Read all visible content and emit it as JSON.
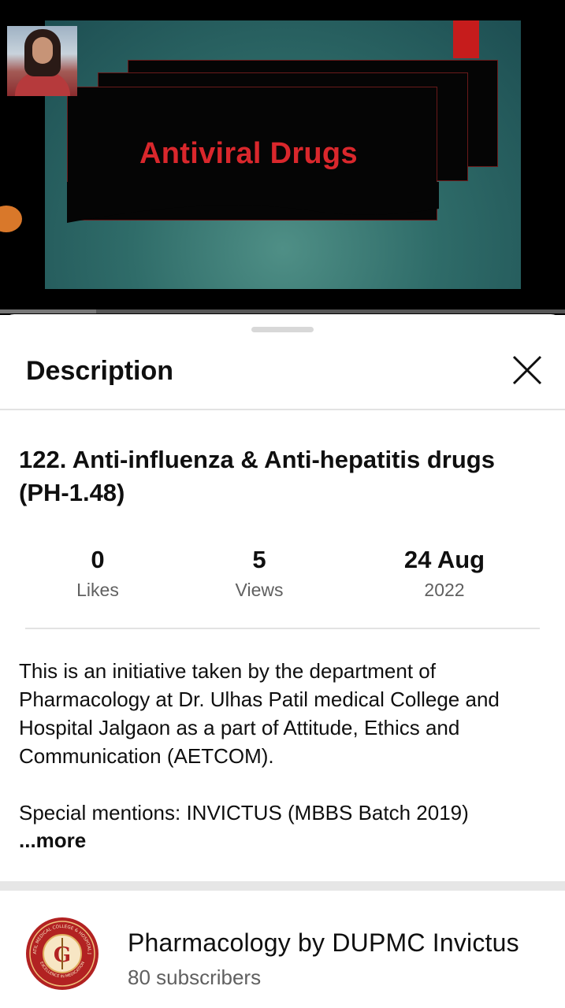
{
  "player": {
    "slide_title": "Antiviral Drugs",
    "progress_fraction": 0.17
  },
  "sheet": {
    "title": "Description",
    "close_icon": "close-icon"
  },
  "video": {
    "title": "122. Anti-influenza & Anti-hepatitis drugs (PH-1.48)"
  },
  "stats": {
    "likes_value": "0",
    "likes_label": "Likes",
    "views_value": "5",
    "views_label": "Views",
    "date_value": "24 Aug",
    "date_year": "2022"
  },
  "description": {
    "paragraph1": "This is an initiative taken by the department of Pharmacology at Dr. Ulhas Patil medical College and Hospital Jalgaon as a part of Attitude, Ethics and Communication (AETCOM).",
    "paragraph2": "Special mentions: INVICTUS (MBBS Batch 2019)",
    "more_label": "...more"
  },
  "channel": {
    "name": "Pharmacology by DUPMC Invictus",
    "subscribers": "80 subscribers",
    "logo_text_top": "ULHAS PATIL MEDICAL COLLEGE & HOSPITAL JALGAON",
    "logo_text_bottom": "EXCELLENCE IN MEDICATION",
    "brand_color": "#b22222"
  }
}
